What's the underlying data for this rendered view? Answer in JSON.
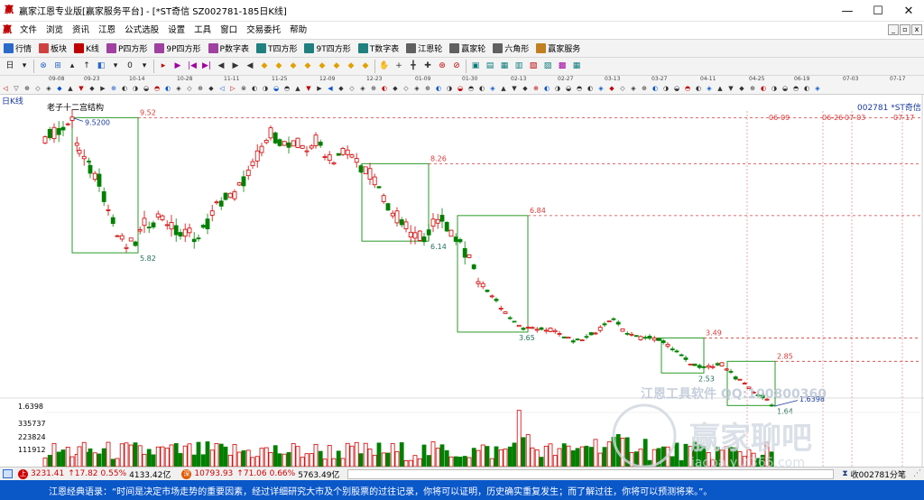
{
  "window": {
    "title": "赢家江恩专业版[赢家服务平台] - [*ST奇信  SZ002781-185日K线]",
    "controls": {
      "minimize": "—",
      "maximize": "☐",
      "close": "✕"
    }
  },
  "menu": {
    "items": [
      "文件",
      "浏览",
      "资讯",
      "江恩",
      "公式选股",
      "设置",
      "工具",
      "窗口",
      "交易委托",
      "帮助"
    ],
    "mdi": [
      "_",
      "▫",
      "x"
    ]
  },
  "toolbar1": {
    "items": [
      {
        "icon": "grid-icon",
        "label": "行情",
        "color": "#2a6ac8"
      },
      {
        "icon": "block-icon",
        "label": "板块",
        "color": "#d04040"
      },
      {
        "icon": "kline-icon",
        "label": "K线",
        "color": "#c00000"
      },
      {
        "icon": "p-square-icon",
        "label": "P四方形",
        "color": "#a040a0"
      },
      {
        "icon": "9p-square-icon",
        "label": "9P四方形",
        "color": "#a040a0"
      },
      {
        "icon": "pn-square-icon",
        "label": "P数字表",
        "color": "#a040a0"
      },
      {
        "icon": "t-square-icon",
        "label": "T四方形",
        "color": "#208080"
      },
      {
        "icon": "9t-square-icon",
        "label": "9T四方形",
        "color": "#208080"
      },
      {
        "icon": "tn-square-icon",
        "label": "T数字表",
        "color": "#208080"
      },
      {
        "icon": "gann-wheel-icon",
        "label": "江恩轮",
        "color": "#606060"
      },
      {
        "icon": "winner-wheel-icon",
        "label": "赢家轮",
        "color": "#606060"
      },
      {
        "icon": "hexagon-icon",
        "label": "六角形",
        "color": "#606060"
      },
      {
        "icon": "service-icon",
        "label": "赢家服务",
        "color": "#c08020"
      }
    ]
  },
  "toolbar2": {
    "buttons": [
      "日",
      "▾",
      "⊗",
      "⊞",
      "▴",
      "↑",
      "◧",
      "▾",
      "0",
      "▾",
      "▸",
      "▶",
      "|◀",
      "▶|",
      "◀",
      "▶",
      "◀",
      "◆",
      "◆",
      "◆",
      "◆",
      "◆",
      "◆",
      "◆",
      "◆",
      "✋",
      "+",
      "╋",
      "✚",
      "⊛",
      "⊘",
      "▣",
      "▤",
      "▦",
      "▥",
      "▧",
      "▨",
      "▩",
      "▦"
    ]
  },
  "ruler": {
    "dates": [
      "09-08",
      "09-23",
      "10-14",
      "10-28",
      "11-11",
      "11-25",
      "12-09",
      "12-23",
      "01-09",
      "01-30",
      "02-13",
      "02-27",
      "03-13",
      "03-27",
      "04-11",
      "04-25",
      "06-19",
      "07-03",
      "07-17"
    ]
  },
  "chart": {
    "period_label": "日K线",
    "study_label": "老子十二宫结构",
    "stock_label": "002781 *ST奇信",
    "watermark_line": "江恩工具软件  QQ:100800360",
    "watermark_logo": "赢家聊吧",
    "watermark_url": "liaoba.yuf365.com",
    "high_label": "9.5200",
    "low_label": "1.6398",
    "box_levels": [
      {
        "top": "9.52",
        "bottom": "5.82"
      },
      {
        "top": "8.26",
        "bottom": "6.14"
      },
      {
        "top": "6.84",
        "bottom": "3.65"
      },
      {
        "top": "3.49",
        "bottom": "2.53"
      },
      {
        "top": "2.85",
        "bottom": "1.64"
      }
    ],
    "future_dates": [
      "06-09",
      "06-26",
      "07-03",
      "07-17"
    ],
    "volume_labels": [
      "1.6398",
      "335737",
      "223824",
      "111912"
    ]
  },
  "statusbar": {
    "sh": {
      "icon": "上",
      "value": "3231.41",
      "change": "17.82",
      "pct": "0.55%",
      "amount": "4133.42亿"
    },
    "sz": {
      "icon": "深",
      "value": "10793.93",
      "change": "71.06",
      "pct": "0.66%",
      "amount": "5763.49亿"
    },
    "right_text": "收002781分笔"
  },
  "quote": {
    "text": "江恩经典语录：“时间是决定市场走势的重要因素，经过详细研究大市及个别股票的过往记录，你将可以证明，历史确实重复发生；而了解过往，你将可以预测将来。”。"
  },
  "colors": {
    "up": "#d00000",
    "down": "#008000",
    "box": "#2a9a2a",
    "level": "#d83a3a",
    "quote_bg": "#0a57c8"
  }
}
